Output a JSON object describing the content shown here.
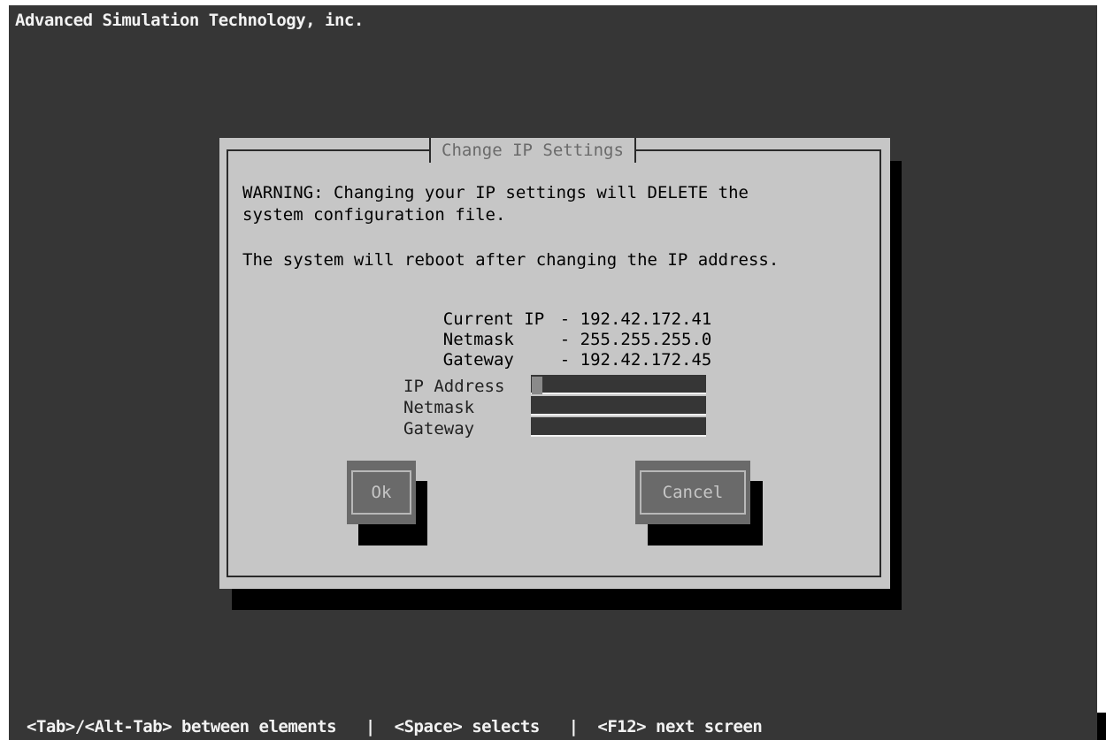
{
  "screen": {
    "root_title": "Advanced Simulation Technology, inc.",
    "helpline": "<Tab>/<Alt-Tab> between elements   |  <Space> selects   |  <F12> next screen",
    "colors": {
      "background": "#363636",
      "window": "#c6c6c6",
      "shadow": "#000000",
      "button": "#6a6a6a",
      "text_light": "#f2f2f2"
    }
  },
  "dialog": {
    "title": "Change IP Settings",
    "warning_line1": "WARNING: Changing your IP settings will DELETE the",
    "warning_line2": "system configuration file.",
    "reboot_note": "The system will reboot after changing the IP address.",
    "current": {
      "ip_label": "Current IP",
      "ip_value": "- 192.42.172.41",
      "netmask_label": "Netmask",
      "netmask_value": "- 255.255.255.0",
      "gateway_label": "Gateway",
      "gateway_value": "- 192.42.172.45"
    },
    "fields": {
      "ip_label": "IP Address",
      "ip_value": "",
      "netmask_label": "Netmask",
      "netmask_value": "",
      "gateway_label": "Gateway",
      "gateway_value": ""
    },
    "buttons": {
      "ok_label": "Ok",
      "cancel_label": "Cancel"
    }
  }
}
